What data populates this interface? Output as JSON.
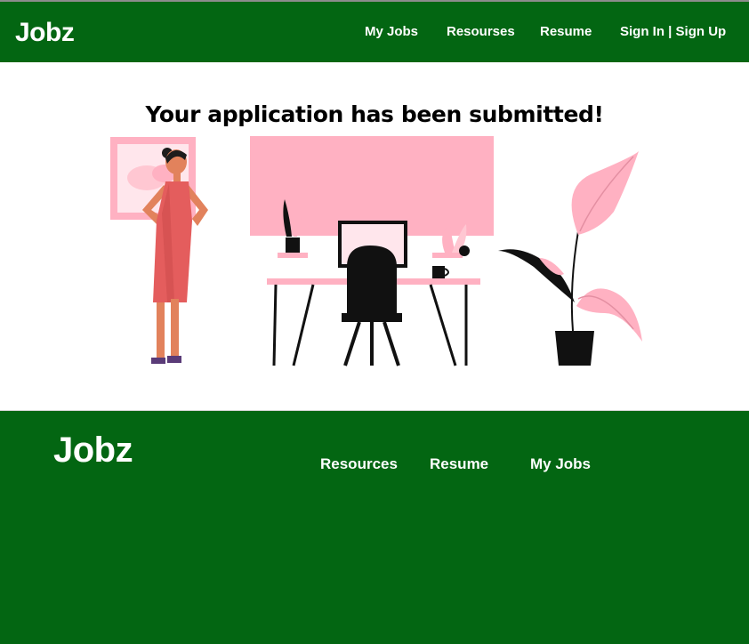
{
  "header": {
    "brand": "Jobz",
    "nav": {
      "my_jobs": "My Jobs",
      "resources": "Resourses",
      "resume": "Resume",
      "sign_in": "Sign In | Sign Up"
    }
  },
  "main": {
    "headline": "Your application has been submitted!",
    "illustration": {
      "scene": "woman standing next to desk with computer and plants",
      "accent_color": "#ffb1c2",
      "skin_color": "#e2825c",
      "dress_color": "#e45d5d"
    }
  },
  "footer": {
    "brand": "Jobz",
    "links": {
      "resources": "Resources",
      "resume": "Resume",
      "my_jobs": "My Jobs"
    }
  },
  "colors": {
    "brand_green": "#036612",
    "white": "#ffffff"
  }
}
